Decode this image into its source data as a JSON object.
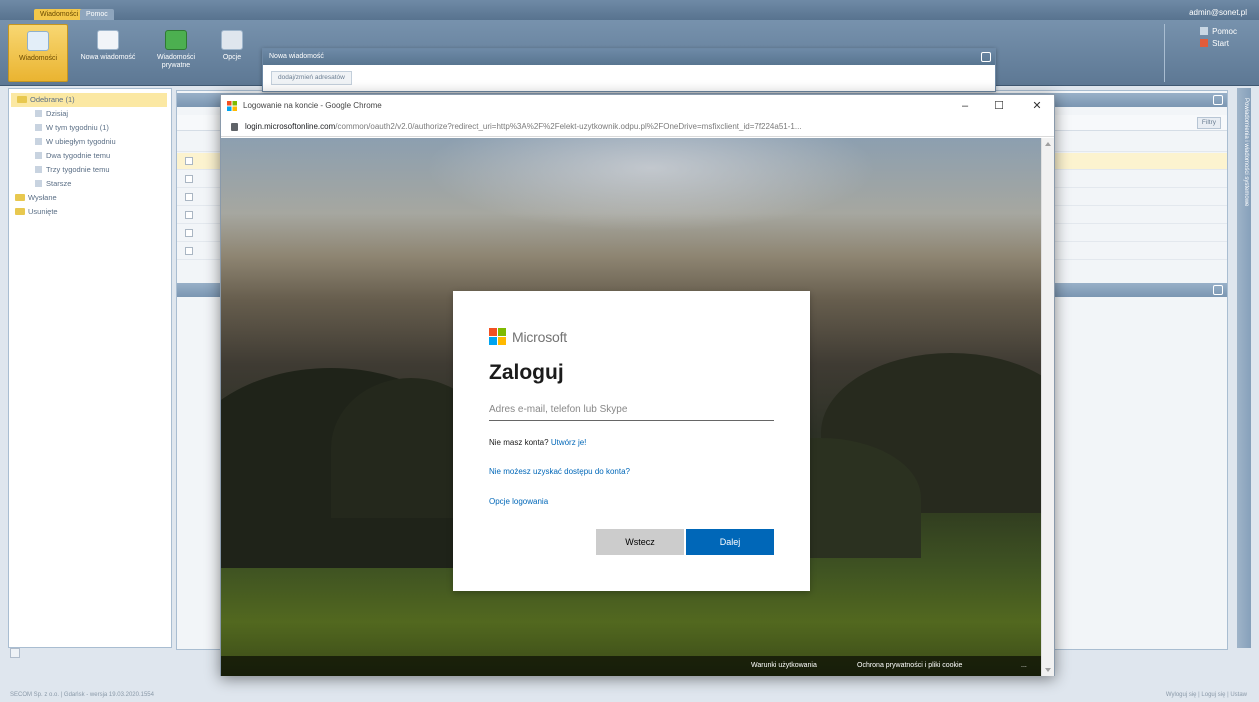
{
  "app": {
    "tabs": [
      "Wiadomości",
      "Pomoc"
    ],
    "user_email": "admin@sonet.pl"
  },
  "ribbon": {
    "buttons": [
      {
        "label": "Wiadomości"
      },
      {
        "label": "Nowa wiadomość"
      },
      {
        "label": "Wiadomości prywatne"
      },
      {
        "label": "Opcje"
      }
    ],
    "right_menu": [
      "Pomoc",
      "Start"
    ]
  },
  "tree": {
    "items": [
      {
        "label": "Odebrane (1)",
        "type": "folder",
        "selected": true
      },
      {
        "label": "Dzisiaj",
        "type": "file"
      },
      {
        "label": "W tym tygodniu (1)",
        "type": "file"
      },
      {
        "label": "W ubiegłym tygodniu",
        "type": "file"
      },
      {
        "label": "Dwa tygodnie temu",
        "type": "file"
      },
      {
        "label": "Trzy tygodnie temu",
        "type": "file"
      },
      {
        "label": "Starsze",
        "type": "file"
      },
      {
        "label": "Wysłane",
        "type": "folder"
      },
      {
        "label": "Usunięte",
        "type": "folder"
      }
    ]
  },
  "main": {
    "filter_label": "Filtry",
    "side_strip": "Powiadomienia i wiadomości systemowe"
  },
  "new_message": {
    "title": "Nowa wiadomość",
    "address_button": "dodaj/zmień adresatów"
  },
  "chrome": {
    "title": "Logowanie na koncie - Google Chrome",
    "url_host": "login.microsoftonline.com",
    "url_rest": "/common/oauth2/v2.0/authorize?redirect_uri=http%3A%2F%2Felekt-uzytkownik.odpu.pl%2FOneDrive=msfixclient_id=7f224a51-1...",
    "controls": [
      "–",
      "☐",
      "✕"
    ]
  },
  "login": {
    "brand": "Microsoft",
    "heading": "Zaloguj",
    "email_placeholder": "Adres e-mail, telefon lub Skype",
    "no_account_text": "Nie masz konta?",
    "create_link": "Utwórz je!",
    "cant_access": "Nie możesz uzyskać dostępu do konta?",
    "sign_in_options": "Opcje logowania",
    "back_button": "Wstecz",
    "next_button": "Dalej",
    "logo_colors": [
      "#f25022",
      "#7fba00",
      "#00a4ef",
      "#ffb900"
    ]
  },
  "page_footer": {
    "links": [
      "Warunki użytkowania",
      "Ochrona prywatności i pliki cookie",
      "..."
    ]
  },
  "status_footer": {
    "left": "SECOM Sp. z o.o. | Gdańsk - wersja 19.03.2020.1554",
    "right": "Wyloguj się | Loguj się | Ustaw"
  }
}
